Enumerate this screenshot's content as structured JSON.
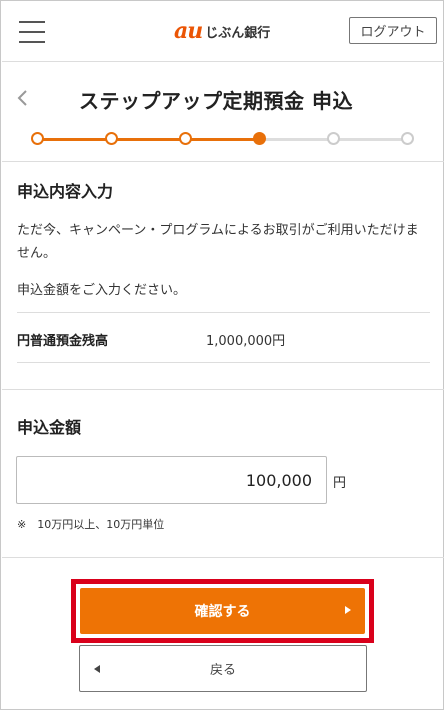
{
  "header": {
    "logo_mark": "au",
    "logo_text": "じぶん銀行",
    "logout_label": "ログアウト"
  },
  "page": {
    "title": "ステップアップ定期預金 申込"
  },
  "stepper": {
    "total_steps": 6,
    "current_step": 4
  },
  "application_details": {
    "heading": "申込内容入力",
    "notice": "ただ今、キャンペーン・プログラムによるお取引がご利用いただけません。",
    "instruction": "申込金額をご入力ください。",
    "balance_label": "円普通預金残高",
    "balance_value": "1,000,000円"
  },
  "amount": {
    "heading": "申込金額",
    "value": "100,000",
    "unit": "円",
    "note": "※　10万円以上、10万円単位"
  },
  "actions": {
    "confirm_label": "確認する",
    "back_label": "戻る"
  },
  "colors": {
    "accent": "#ee7305",
    "highlight": "#d9001b",
    "step_inactive": "#cccccc"
  }
}
